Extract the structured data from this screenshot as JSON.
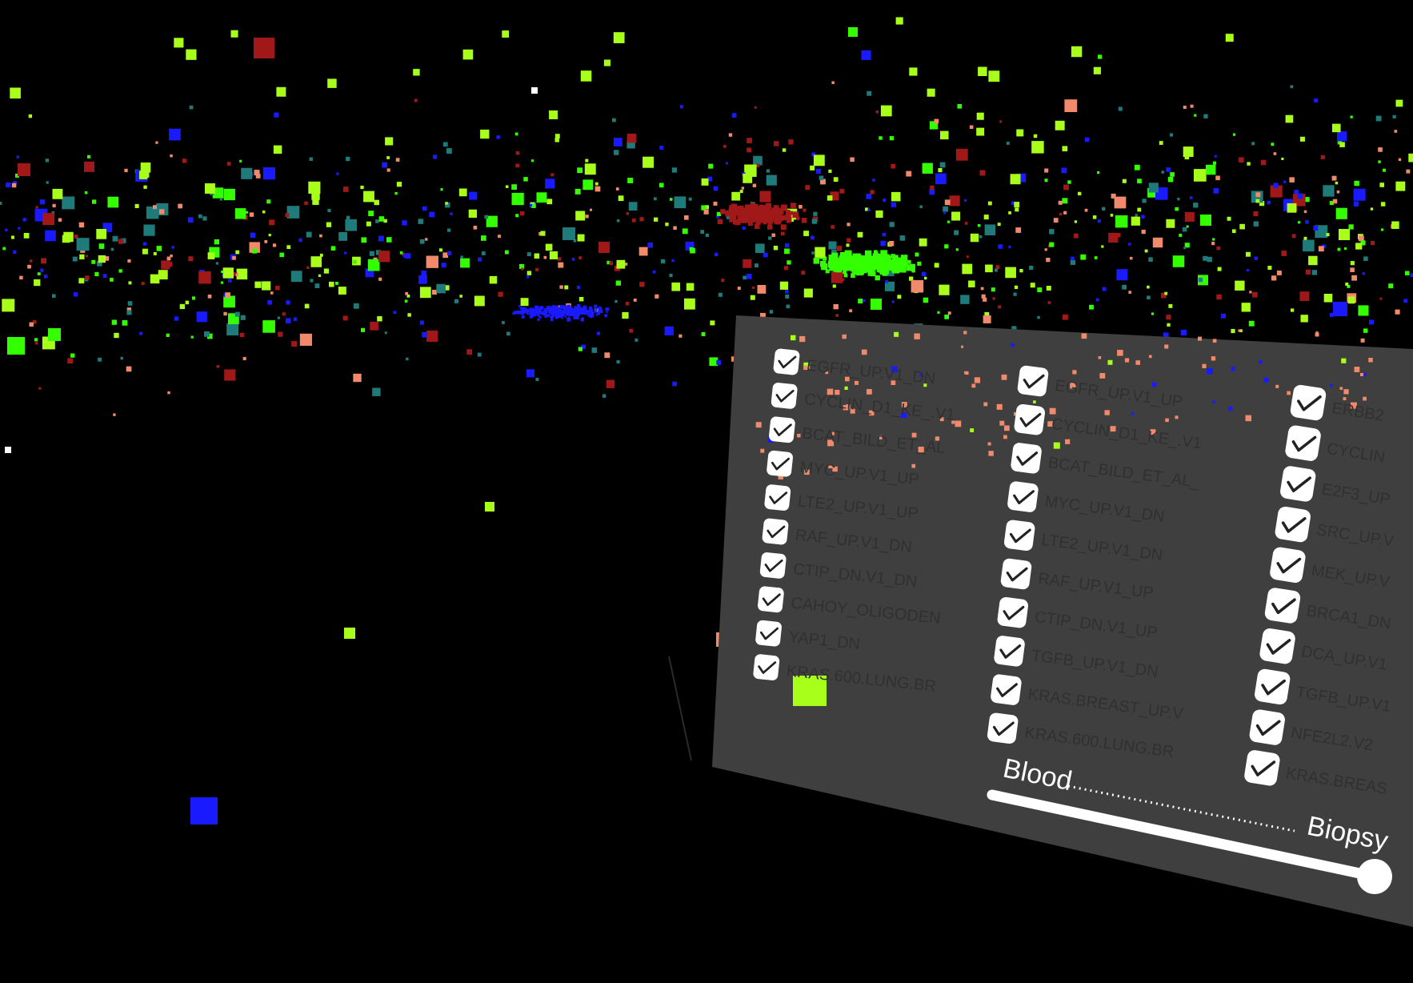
{
  "colors": {
    "background": "#000000",
    "panel": "#3f3f3f",
    "checkbox_bg": "#ffffff",
    "checkmark": "#222222",
    "label": "#303030",
    "slider_track": "#ffffff",
    "series_red": "#a01818",
    "series_green": "#33ff00",
    "series_lime": "#a8ff1a",
    "series_blue": "#1a1aff",
    "series_salmon": "#f08a6a",
    "series_teal": "#1f7a7a",
    "series_white": "#ffffff"
  },
  "panel": {
    "columns": [
      {
        "items": [
          {
            "label": "EGFR_UP.V1_DN",
            "checked": true
          },
          {
            "label": "CYCLIN_D1_KE_.V1",
            "checked": true
          },
          {
            "label": "BCAT_BILD_ET_AL",
            "checked": true
          },
          {
            "label": "MYC_UP.V1_UP",
            "checked": true
          },
          {
            "label": "LTE2_UP.V1_UP",
            "checked": true
          },
          {
            "label": "RAF_UP.V1_DN",
            "checked": true
          },
          {
            "label": "CTIP_DN.V1_DN",
            "checked": true
          },
          {
            "label": "CAHOY_OLIGODEN",
            "checked": true
          },
          {
            "label": "YAP1_DN",
            "checked": true
          },
          {
            "label": "KRAS.600.LUNG.BR",
            "checked": true
          }
        ]
      },
      {
        "items": [
          {
            "label": "EGFR_UP.V1_UP",
            "checked": true
          },
          {
            "label": "CYCLIN_D1_KE_.V1",
            "checked": true
          },
          {
            "label": "BCAT_BILD_ET_AL_",
            "checked": true
          },
          {
            "label": "MYC_UP.V1_DN",
            "checked": true
          },
          {
            "label": "LTE2_UP.V1_DN",
            "checked": true
          },
          {
            "label": "RAF_UP.V1_UP",
            "checked": true
          },
          {
            "label": "CTIP_DN.V1_UP",
            "checked": true
          },
          {
            "label": "TGFB_UP.V1_DN",
            "checked": true
          },
          {
            "label": "KRAS.BREAST_UP.V",
            "checked": true
          },
          {
            "label": "KRAS.600.LUNG.BR",
            "checked": true
          }
        ]
      },
      {
        "items": [
          {
            "label": "ERBB2",
            "checked": true
          },
          {
            "label": "CYCLIN",
            "checked": true
          },
          {
            "label": "E2F3_UP",
            "checked": true
          },
          {
            "label": "SRC_UP.V",
            "checked": true
          },
          {
            "label": "MEK_UP.V",
            "checked": true
          },
          {
            "label": "BRCA1_DN",
            "checked": true
          },
          {
            "label": "DCA_UP.V1",
            "checked": true
          },
          {
            "label": "TGFB_UP.V1",
            "checked": true
          },
          {
            "label": "NFE2L2.V2",
            "checked": true
          },
          {
            "label": "KRAS.BREAS",
            "checked": true
          }
        ]
      }
    ],
    "slider": {
      "left_label": "Blood",
      "right_label": "Biopsy",
      "value": 1.0
    }
  }
}
